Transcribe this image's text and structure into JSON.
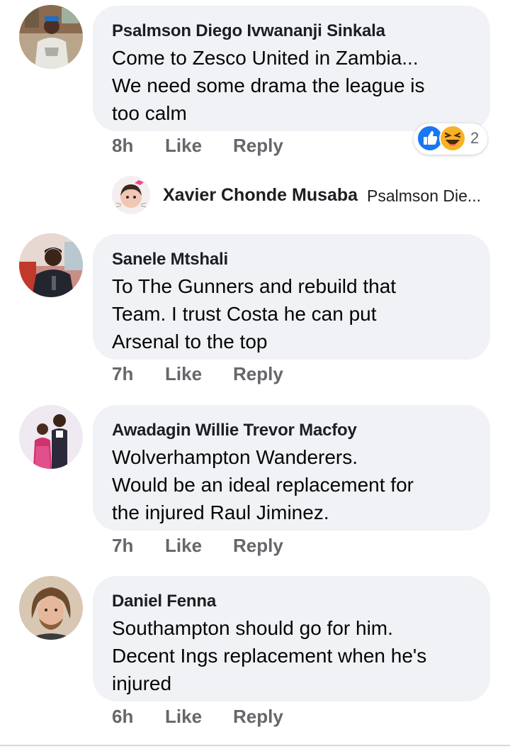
{
  "comments": [
    {
      "author": "Psalmson Diego Ivwananji Sinkala",
      "lines": [
        "Come to Zesco United in Zambia...",
        "We need some drama the league is",
        "too calm"
      ],
      "time": "8h",
      "like_label": "Like",
      "reply_label": "Reply",
      "reactions": {
        "icons": [
          "like-icon",
          "haha-icon"
        ],
        "count": "2",
        "colors": {
          "like": "#1877f2",
          "haha": "#f7b125"
        }
      },
      "reply_preview": {
        "author": "Xavier Chonde Musaba",
        "text": "Psalmson Die..."
      }
    },
    {
      "author": "Sanele Mtshali",
      "lines": [
        "To The Gunners and rebuild that",
        "Team. I trust Costa he can put",
        "Arsenal to the top"
      ],
      "time": "7h",
      "like_label": "Like",
      "reply_label": "Reply"
    },
    {
      "author": "Awadagin Willie Trevor Macfoy",
      "lines": [
        "Wolverhampton Wanderers.",
        "Would be an ideal replacement for",
        "the injured Raul Jiminez."
      ],
      "time": "7h",
      "like_label": "Like",
      "reply_label": "Reply"
    },
    {
      "author": "Daniel Fenna",
      "lines": [
        "Southampton should go for him.",
        "Decent Ings replacement when he's",
        "injured"
      ],
      "time": "6h",
      "like_label": "Like",
      "reply_label": "Reply"
    }
  ],
  "colors": {
    "bubble": "#f0f2f5",
    "meta_text": "#65676b",
    "name_text": "#1c1e21"
  }
}
